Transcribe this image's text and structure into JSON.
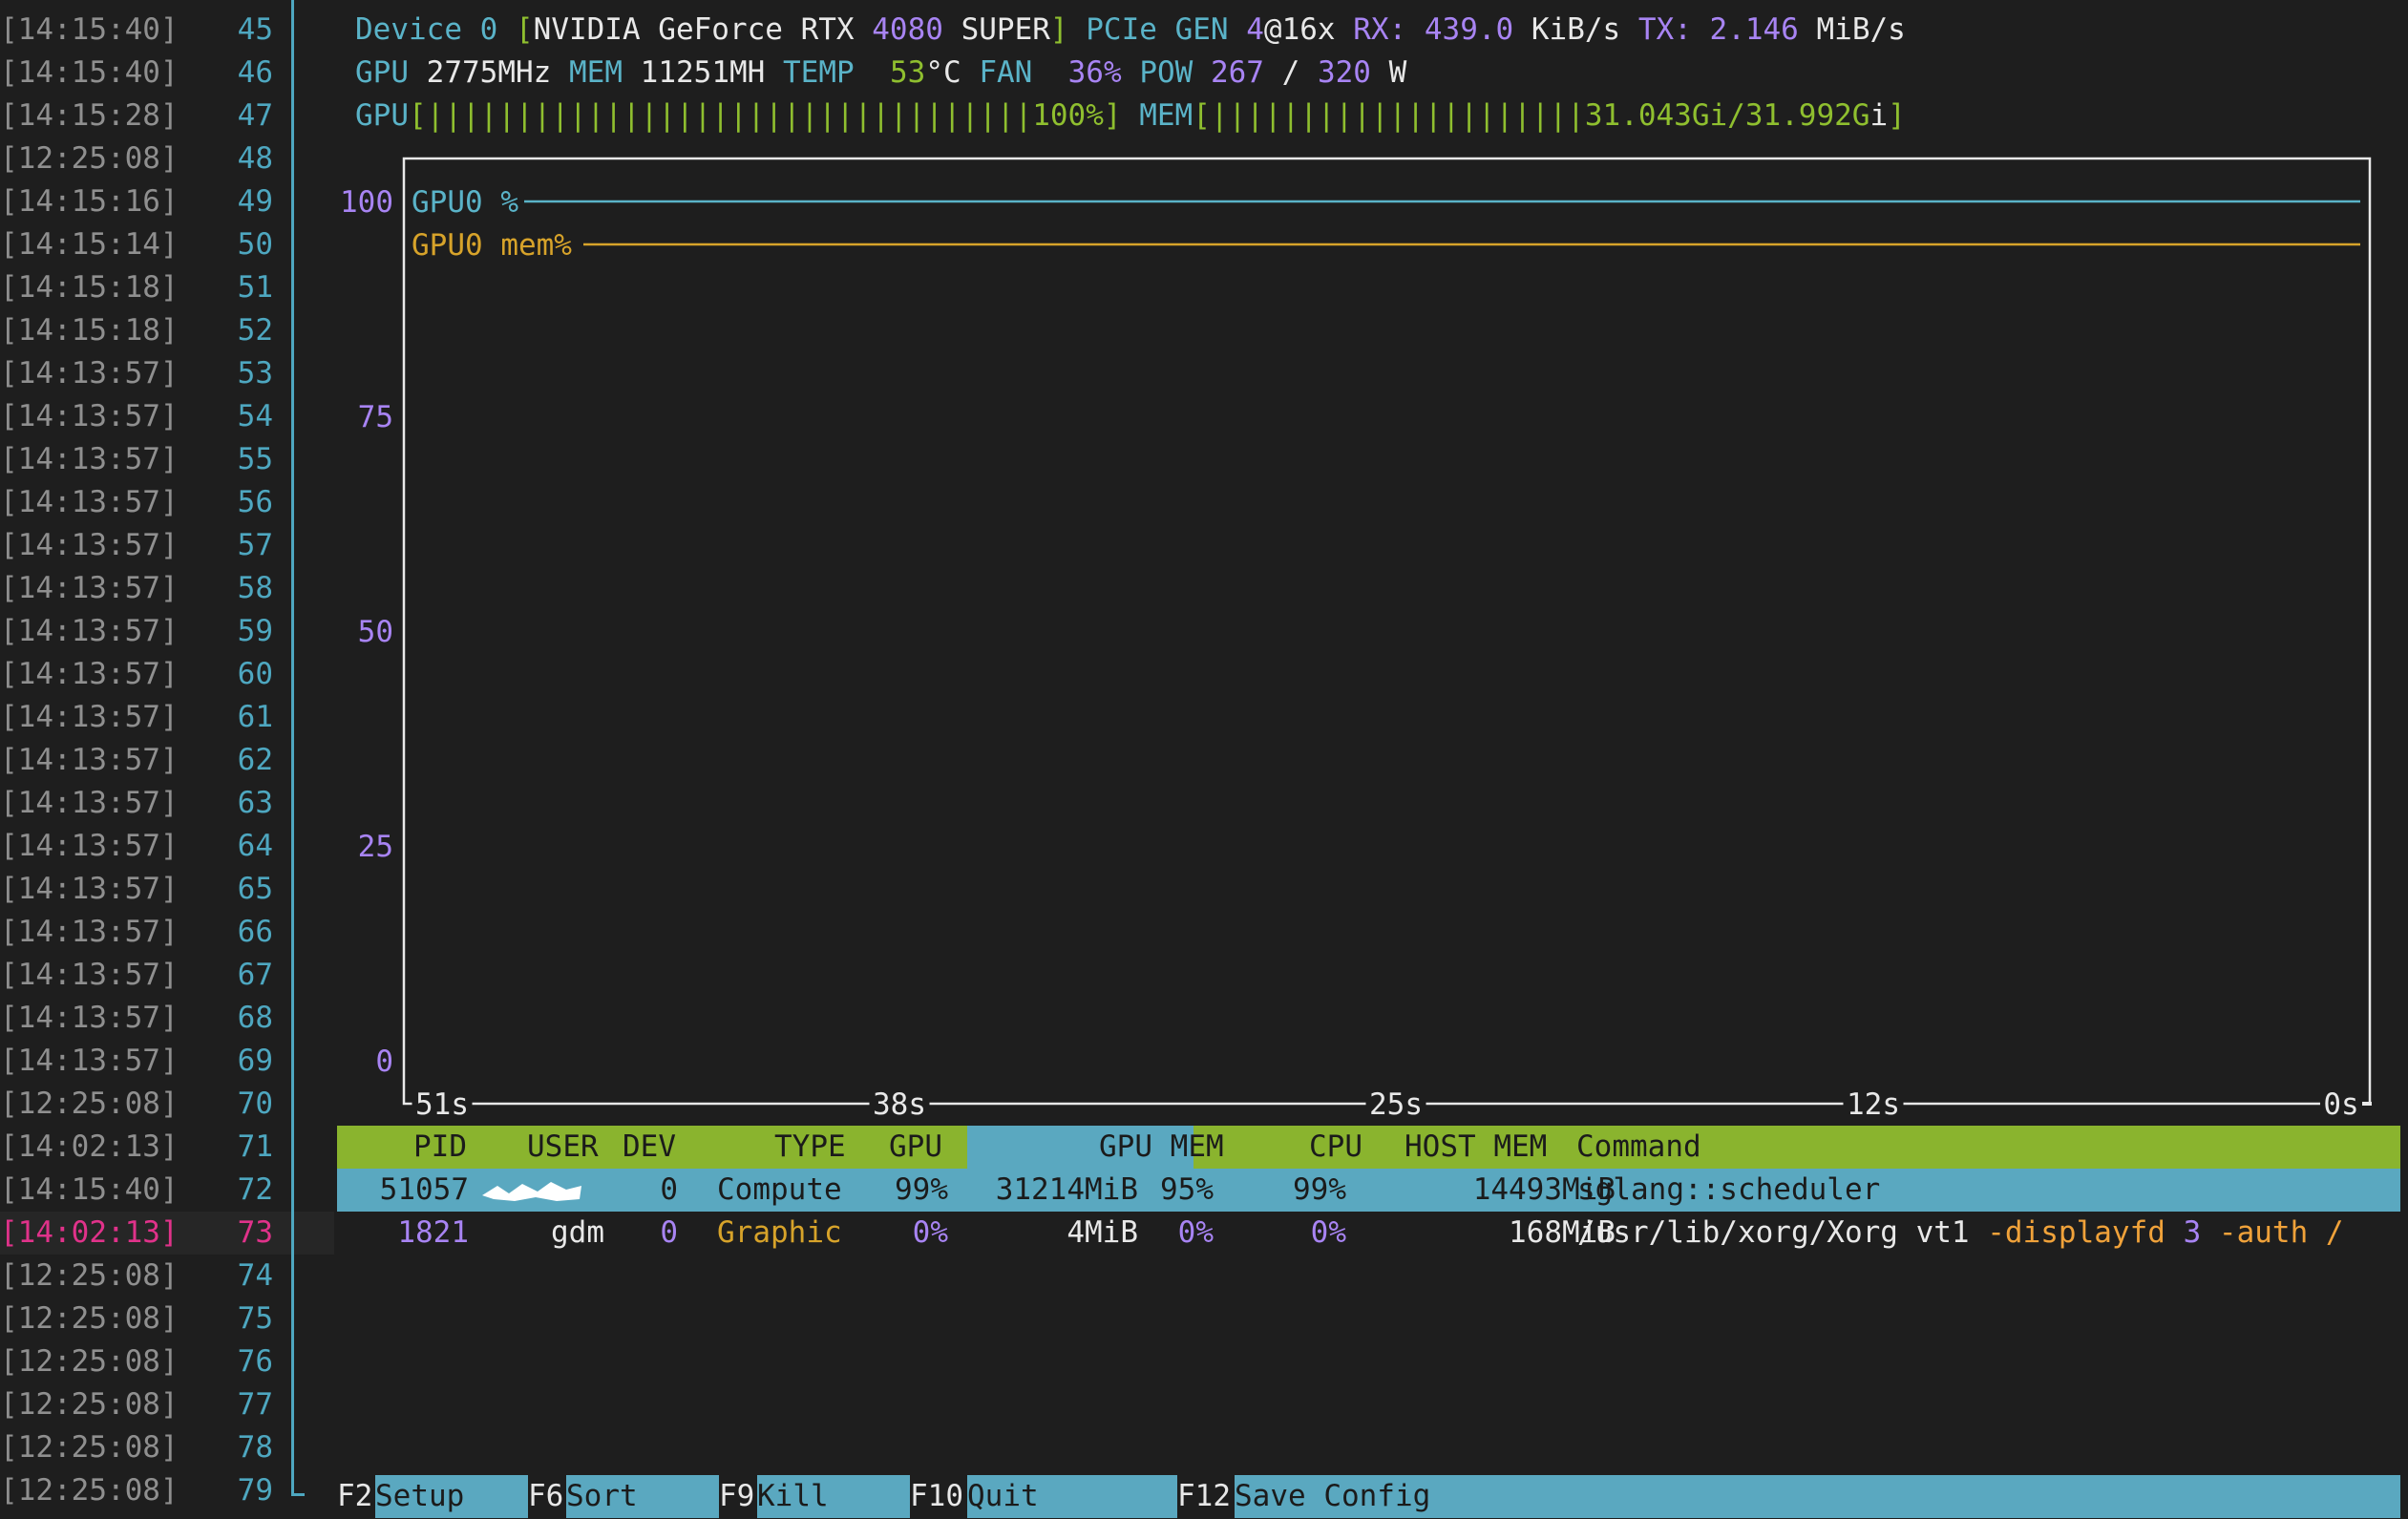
{
  "gutter": {
    "lines": [
      {
        "ts": "[14:15:40]",
        "n": "45"
      },
      {
        "ts": "[14:15:40]",
        "n": "46"
      },
      {
        "ts": "[14:15:28]",
        "n": "47"
      },
      {
        "ts": "[12:25:08]",
        "n": "48"
      },
      {
        "ts": "[14:15:16]",
        "n": "49"
      },
      {
        "ts": "[14:15:14]",
        "n": "50"
      },
      {
        "ts": "[14:15:18]",
        "n": "51"
      },
      {
        "ts": "[14:15:18]",
        "n": "52"
      },
      {
        "ts": "[14:13:57]",
        "n": "53"
      },
      {
        "ts": "[14:13:57]",
        "n": "54"
      },
      {
        "ts": "[14:13:57]",
        "n": "55"
      },
      {
        "ts": "[14:13:57]",
        "n": "56"
      },
      {
        "ts": "[14:13:57]",
        "n": "57"
      },
      {
        "ts": "[14:13:57]",
        "n": "58"
      },
      {
        "ts": "[14:13:57]",
        "n": "59"
      },
      {
        "ts": "[14:13:57]",
        "n": "60"
      },
      {
        "ts": "[14:13:57]",
        "n": "61"
      },
      {
        "ts": "[14:13:57]",
        "n": "62"
      },
      {
        "ts": "[14:13:57]",
        "n": "63"
      },
      {
        "ts": "[14:13:57]",
        "n": "64"
      },
      {
        "ts": "[14:13:57]",
        "n": "65"
      },
      {
        "ts": "[14:13:57]",
        "n": "66"
      },
      {
        "ts": "[14:13:57]",
        "n": "67"
      },
      {
        "ts": "[14:13:57]",
        "n": "68"
      },
      {
        "ts": "[14:13:57]",
        "n": "69"
      },
      {
        "ts": "[12:25:08]",
        "n": "70"
      },
      {
        "ts": "[14:02:13]",
        "n": "71"
      },
      {
        "ts": "[14:15:40]",
        "n": "72"
      },
      {
        "ts": "[14:02:13]",
        "n": "73",
        "current": true
      },
      {
        "ts": "[12:25:08]",
        "n": "74"
      },
      {
        "ts": "[12:25:08]",
        "n": "75"
      },
      {
        "ts": "[12:25:08]",
        "n": "76"
      },
      {
        "ts": "[12:25:08]",
        "n": "77"
      },
      {
        "ts": "[12:25:08]",
        "n": "78"
      },
      {
        "ts": "[12:25:08]",
        "n": "79"
      }
    ]
  },
  "device": {
    "label": "Device 0",
    "name": "NVIDIA GeForce RTX ",
    "model_num": "4080",
    "model_suffix": " SUPER",
    "pcie_label": "PCIe GEN ",
    "pcie_gen": "4",
    "pcie_width": "@16x",
    "rx_label": "RX: ",
    "rx_value": "439.0",
    "rx_unit": " KiB/s",
    "tx_label": "TX: ",
    "tx_value": "2.146",
    "tx_unit": " MiB/s"
  },
  "stats": {
    "gpu_label": "GPU",
    "gpu_clock": "2775MHz",
    "mem_label": "MEM",
    "mem_clock": "11251MH",
    "temp_label": "TEMP",
    "temp_value": "53",
    "temp_unit": "°C",
    "fan_label": "FAN",
    "fan_value": "36%",
    "pow_label": "POW",
    "pow_value": "267",
    "pow_sep": " / ",
    "pow_max": "320",
    "pow_unit": " W"
  },
  "bars": {
    "gpu_label": "GPU",
    "gpu_fill": "||||||||||||||||||||||||||||||||||",
    "gpu_text": "100%",
    "gpu_util": 1.0,
    "mem_label": "MEM",
    "mem_fill": "|||||||||||||||||||||",
    "mem_text": "31.043Gi/31.992G",
    "mem_text_tail": "i",
    "mem_used_fraction": 0.97
  },
  "chart_data": {
    "type": "line",
    "yticks": [
      "100",
      "75",
      "50",
      "25",
      "0"
    ],
    "ylim": [
      0,
      100
    ],
    "xticks": [
      "51s",
      "38s",
      "25s",
      "12s",
      "0s"
    ],
    "series": [
      {
        "name": "GPU0 %",
        "color": "#5ab3c8",
        "values": [
          100,
          100
        ]
      },
      {
        "name": "GPU0 mem%",
        "color": "#d7a32a",
        "values": [
          95,
          95
        ]
      }
    ]
  },
  "process_table": {
    "headers": [
      "PID",
      "USER",
      "DEV",
      "TYPE",
      "GPU",
      "GPU MEM",
      "CPU",
      "HOST MEM",
      "Command"
    ],
    "rows": [
      {
        "pid": "51057",
        "user": "",
        "dev": "0",
        "type": "Compute",
        "gpu": "99%",
        "gpumem": "31214MiB",
        "gpumem_pct": "95%",
        "cpu": "99%",
        "hostmem": "14493MiB",
        "command": "sglang::scheduler",
        "selected": true
      },
      {
        "pid": "1821",
        "user": "gdm",
        "dev": "0",
        "type": "Graphic",
        "gpu": "0%",
        "gpumem": "4MiB",
        "gpumem_pct": "0%",
        "cpu": "0%",
        "hostmem": "168MiB",
        "command": "/usr/lib/xorg/Xorg vt1 ",
        "cmd_arg1": "-displayfd ",
        "cmd_arg2": "3",
        "cmd_arg3": " -auth /",
        "selected": false
      }
    ]
  },
  "function_keys": [
    {
      "key": "F2",
      "label": "Setup"
    },
    {
      "key": "F6",
      "label": "Sort"
    },
    {
      "key": "F9",
      "label": "Kill"
    },
    {
      "key": "F10",
      "label": "Quit"
    },
    {
      "key": "F12",
      "label": "Save Config"
    }
  ],
  "colors": {
    "accent_cyan": "#5ab3c8",
    "purple": "#a884f3",
    "green": "#8fbf2f",
    "header_green": "#8ab42e",
    "selection_blue": "#5aa8c0",
    "gold": "#d7a32a",
    "orange": "#f0a23a",
    "current_line_pink": "#e0328a",
    "background": "#1e1e1e"
  }
}
